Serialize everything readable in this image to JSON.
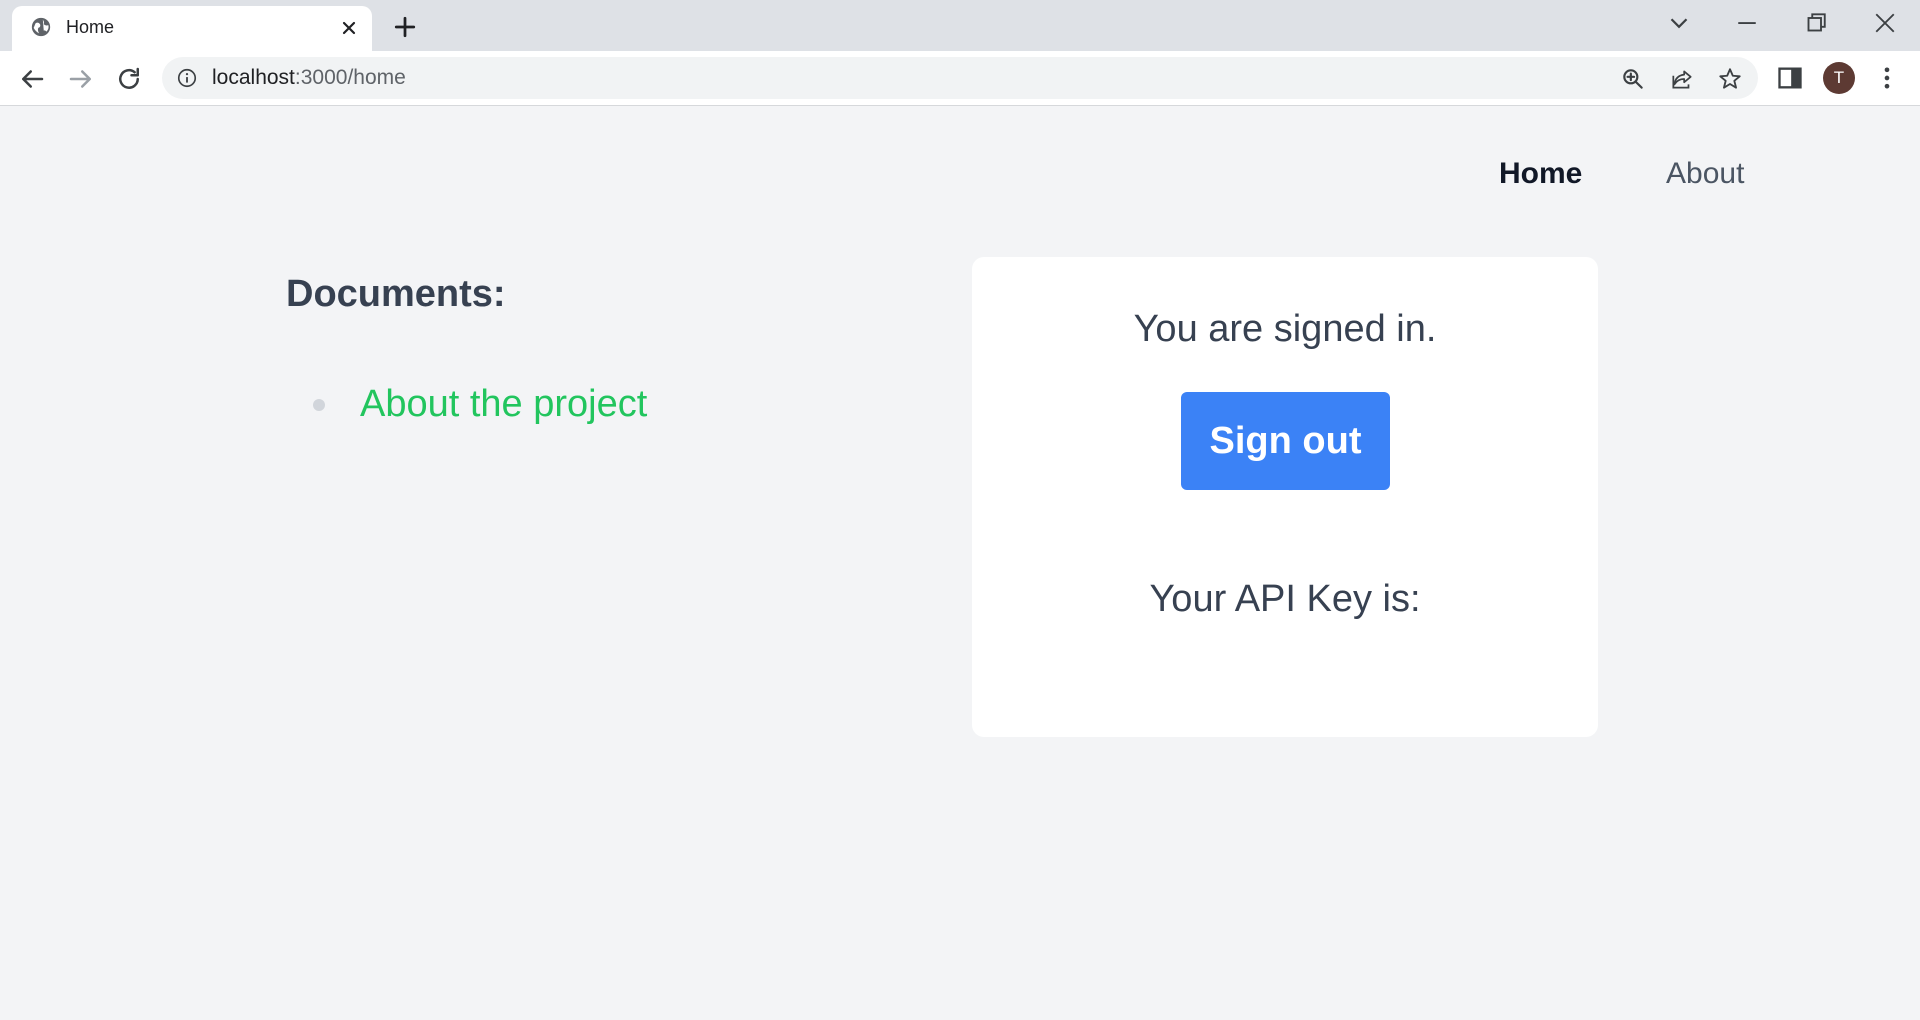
{
  "browser": {
    "tab": {
      "title": "Home"
    },
    "url": {
      "host": "localhost",
      "path": ":3000/home"
    },
    "profile_initial": "T"
  },
  "nav": {
    "home_label": "Home",
    "about_label": "About"
  },
  "documents": {
    "heading": "Documents:",
    "items": [
      {
        "label": "About the project"
      }
    ]
  },
  "auth_card": {
    "status_text": "You are signed in.",
    "signout_label": "Sign out",
    "api_key_label": "Your API Key is:"
  },
  "colors": {
    "link": "#22c55e",
    "button": "#3b82f6",
    "page_bg": "#f3f4f6"
  }
}
